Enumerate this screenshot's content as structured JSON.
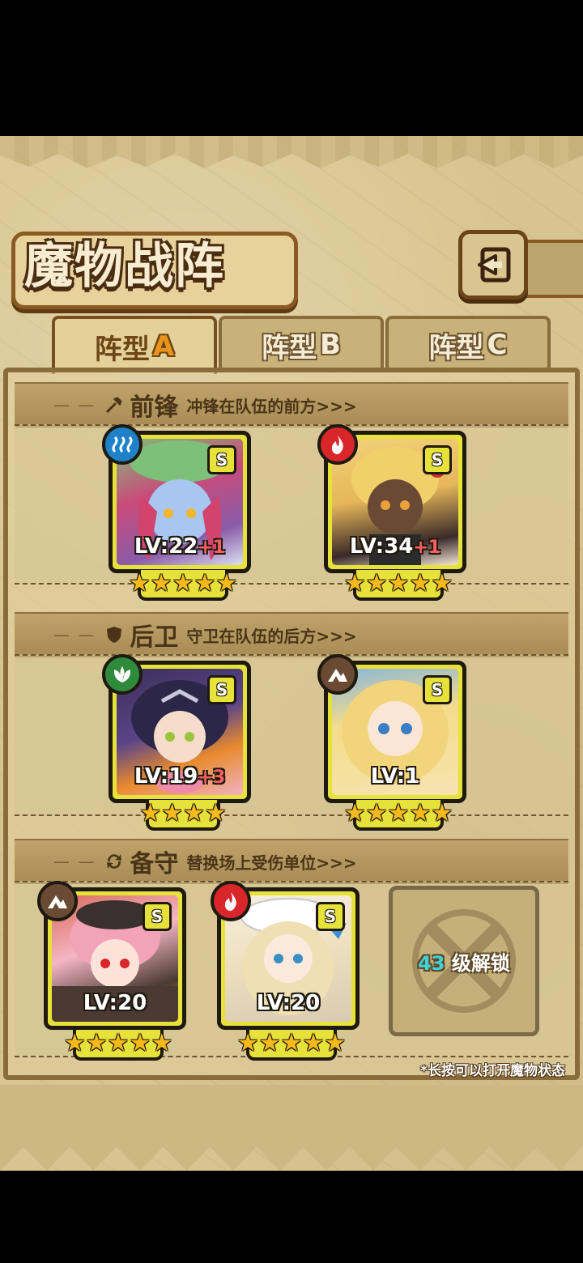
{
  "title": "魔物战阵",
  "tabs": [
    {
      "prefix": "阵型",
      "letter": "A",
      "active": true
    },
    {
      "prefix": "阵型",
      "letter": "B",
      "active": false
    },
    {
      "prefix": "阵型",
      "letter": "C",
      "active": false
    }
  ],
  "sections": {
    "front": {
      "name": "前锋",
      "desc": "冲锋在队伍的前方>>>"
    },
    "rear": {
      "name": "后卫",
      "desc": "守卫在队伍的后方>>>"
    },
    "reserve": {
      "name": "备守",
      "desc": "替换场上受伤单位>>>"
    }
  },
  "cards": {
    "front1": {
      "element": "water-element-icon",
      "grade": "S",
      "lv": "LV:22",
      "plus": "+1",
      "stars": 5
    },
    "front2": {
      "element": "fire-element-icon",
      "grade": "S",
      "lv": "LV:34",
      "plus": "+1",
      "stars": 5
    },
    "rear1": {
      "element": "wood-element-icon",
      "grade": "S",
      "lv": "LV:19",
      "plus": "+3",
      "stars": 4
    },
    "rear2": {
      "element": "earth-element-icon",
      "grade": "S",
      "lv": "LV:1",
      "plus": "",
      "stars": 5
    },
    "reserve1": {
      "element": "earth-element-icon",
      "grade": "S",
      "lv": "LV:20",
      "plus": "",
      "stars": 5
    },
    "reserve2": {
      "element": "fire-element-icon",
      "grade": "S",
      "lv": "LV:20",
      "plus": "",
      "stars": 5
    }
  },
  "locked_slot": {
    "level": "43",
    "label": "级解锁"
  },
  "footnote": "*长按可以打开魔物状态",
  "colors": {
    "card_frame": "#e7e23a",
    "water": "#1f82c9",
    "fire": "#d8262a",
    "wood": "#2f8a3b",
    "earth": "#6a4a33",
    "star": "#f5b91a"
  }
}
